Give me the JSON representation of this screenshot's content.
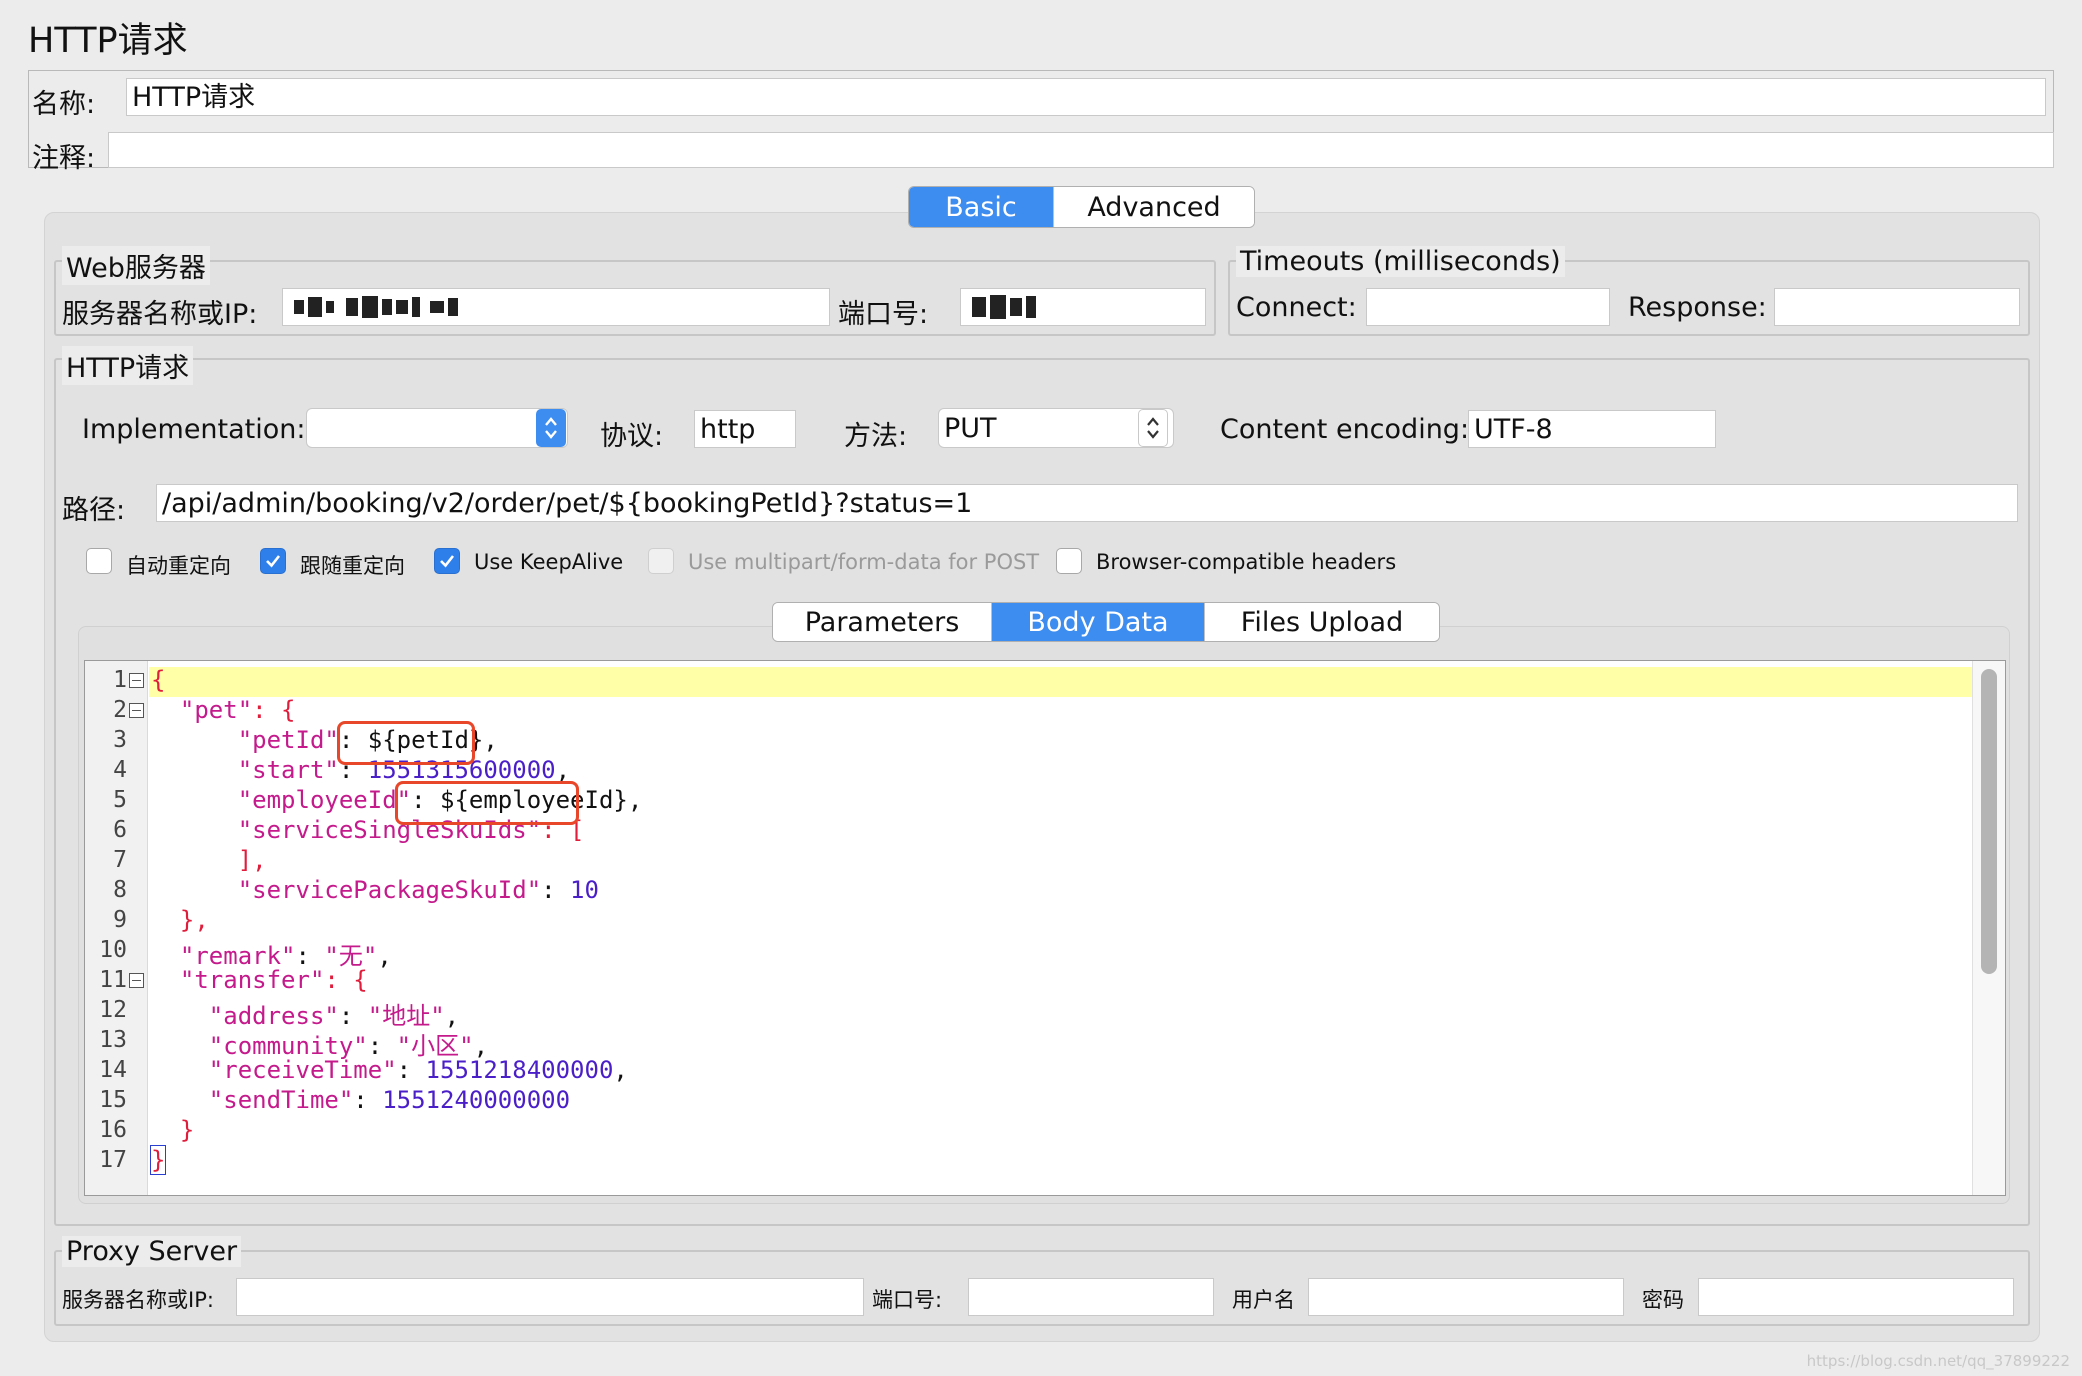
{
  "window_title": "HTTP请求",
  "header": {
    "name_label": "名称:",
    "name_value": "HTTP请求",
    "comment_label": "注释:",
    "comment_value": ""
  },
  "main_tabs": [
    {
      "label": "Basic",
      "active": true
    },
    {
      "label": "Advanced",
      "active": false
    }
  ],
  "web_server": {
    "legend": "Web服务器",
    "server_label": "服务器名称或IP:",
    "port_label": "端口号:"
  },
  "timeouts": {
    "legend": "Timeouts (milliseconds)",
    "connect_label": "Connect:",
    "connect_value": "",
    "response_label": "Response:",
    "response_value": ""
  },
  "http_request": {
    "legend": "HTTP请求",
    "implementation_label": "Implementation:",
    "implementation_value": "",
    "protocol_label": "协议:",
    "protocol_value": "http",
    "method_label": "方法:",
    "method_value": "PUT",
    "encoding_label": "Content encoding:",
    "encoding_value": "UTF-8",
    "path_label": "路径:",
    "path_value": "/api/admin/booking/v2/order/pet/${bookingPetId}?status=1"
  },
  "checkboxes": [
    {
      "label": "自动重定向",
      "checked": false,
      "disabled": false
    },
    {
      "label": "跟随重定向",
      "checked": true,
      "disabled": false
    },
    {
      "label": "Use KeepAlive",
      "checked": true,
      "disabled": false
    },
    {
      "label": "Use multipart/form-data for POST",
      "checked": false,
      "disabled": true
    },
    {
      "label": "Browser-compatible headers",
      "checked": false,
      "disabled": false
    }
  ],
  "body_tabs": [
    {
      "label": "Parameters",
      "active": false
    },
    {
      "label": "Body Data",
      "active": true
    },
    {
      "label": "Files Upload",
      "active": false
    }
  ],
  "body_lines": [
    "1",
    "2",
    "3",
    "4",
    "5",
    "6",
    "7",
    "8",
    "9",
    "10",
    "11",
    "12",
    "13",
    "14",
    "15",
    "16",
    "17"
  ],
  "body_code": {
    "l1": "{",
    "l2_key": "\"pet\"",
    "l2_rest": ": {",
    "l3_key": "\"petId\"",
    "l3_var": "${petId}",
    "l4_key": "\"start\"",
    "l4_val": "1551315600000",
    "l5_key": "\"employeeId\"",
    "l5_var": "${employeeId}",
    "l6_key": "\"serviceSingleSkuIds\"",
    "l6_rest": ": [",
    "l7": "],",
    "l8_key": "\"servicePackageSkuId\"",
    "l8_val": "10",
    "l9": "},",
    "l10_key": "\"remark\"",
    "l10_val": "\"无\"",
    "l11_key": "\"transfer\"",
    "l11_rest": ": {",
    "l12_key": "\"address\"",
    "l12_val": "\"地址\"",
    "l13_key": "\"community\"",
    "l13_val": "\"小区\"",
    "l14_key": "\"receiveTime\"",
    "l14_val": "1551218400000",
    "l15_key": "\"sendTime\"",
    "l15_val": "1551240000000",
    "l16": "}",
    "l17": "}"
  },
  "proxy": {
    "legend": "Proxy Server",
    "server_label": "服务器名称或IP:",
    "port_label": "端口号:",
    "user_label": "用户名",
    "password_label": "密码"
  },
  "colors": {
    "tab_active": "#3d8cf0",
    "checkbox_on": "#2f7fea",
    "json_key": "#c41a8c",
    "json_brace": "#e01e3c",
    "json_number": "#4b1fc8",
    "highlight_box": "#e8472a",
    "current_line": "#ffffa8"
  },
  "icons": [
    "chevron-updown-icon",
    "checkmark-icon",
    "fold-minus-icon"
  ],
  "watermark": "https://blog.csdn.net/qq_37899222"
}
